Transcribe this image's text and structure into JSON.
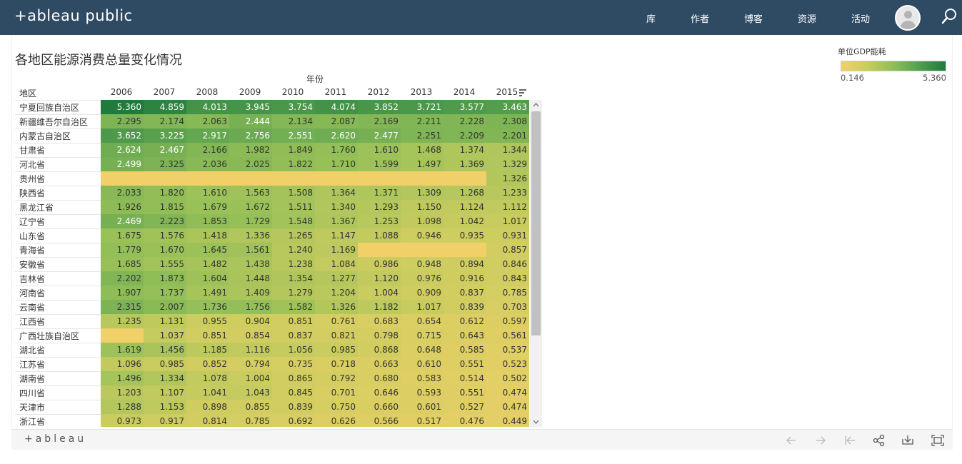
{
  "nav": {
    "logo_text": "+ableau public",
    "items": [
      "库",
      "作者",
      "博客",
      "资源",
      "活动"
    ]
  },
  "viz": {
    "title": "各地区能源消费总量变化情况",
    "column_header": "年份",
    "row_header": "地区",
    "legend": {
      "title": "单位GDP能耗",
      "min": "0.146",
      "max": "5.360"
    },
    "years": [
      "2006",
      "2007",
      "2008",
      "2009",
      "2010",
      "2011",
      "2012",
      "2013",
      "2014",
      "2015"
    ],
    "rows": [
      {
        "region": "宁夏回族自治区",
        "values": [
          "5.360",
          "4.859",
          "4.013",
          "3.945",
          "3.754",
          "4.074",
          "3.852",
          "3.721",
          "3.577",
          "3.463"
        ]
      },
      {
        "region": "新疆维吾尔自治区",
        "values": [
          "2.295",
          "2.174",
          "2.063",
          "2.444",
          "2.134",
          "2.087",
          "2.169",
          "2.211",
          "2.228",
          "2.308"
        ]
      },
      {
        "region": "内蒙古自治区",
        "values": [
          "3.652",
          "3.225",
          "2.917",
          "2.756",
          "2.551",
          "2.620",
          "2.477",
          "2.251",
          "2.209",
          "2.201"
        ]
      },
      {
        "region": "甘肃省",
        "values": [
          "2.624",
          "2.467",
          "2.166",
          "1.982",
          "1.849",
          "1.760",
          "1.610",
          "1.468",
          "1.374",
          "1.344"
        ]
      },
      {
        "region": "河北省",
        "values": [
          "2.499",
          "2.325",
          "2.036",
          "2.025",
          "1.822",
          "1.710",
          "1.599",
          "1.497",
          "1.369",
          "1.329"
        ]
      },
      {
        "region": "贵州省",
        "values": [
          "",
          "",
          "",
          "",
          "",
          "",
          "",
          "",
          "",
          "1.326"
        ]
      },
      {
        "region": "陕西省",
        "values": [
          "2.033",
          "1.820",
          "1.610",
          "1.563",
          "1.508",
          "1.364",
          "1.371",
          "1.309",
          "1.268",
          "1.233"
        ]
      },
      {
        "region": "黑龙江省",
        "values": [
          "1.926",
          "1.815",
          "1.679",
          "1.672",
          "1.511",
          "1.340",
          "1.293",
          "1.150",
          "1.124",
          "1.112"
        ]
      },
      {
        "region": "辽宁省",
        "values": [
          "2.469",
          "2.223",
          "1.853",
          "1.729",
          "1.548",
          "1.367",
          "1.253",
          "1.098",
          "1.042",
          "1.017"
        ]
      },
      {
        "region": "山东省",
        "values": [
          "1.675",
          "1.576",
          "1.418",
          "1.336",
          "1.265",
          "1.147",
          "1.088",
          "0.946",
          "0.935",
          "0.931"
        ]
      },
      {
        "region": "青海省",
        "values": [
          "1.779",
          "1.670",
          "1.645",
          "1.561",
          "1.240",
          "1.169",
          "",
          "",
          "",
          "0.857"
        ]
      },
      {
        "region": "安徽省",
        "values": [
          "1.685",
          "1.555",
          "1.482",
          "1.438",
          "1.238",
          "1.084",
          "0.986",
          "0.948",
          "0.894",
          "0.846"
        ]
      },
      {
        "region": "吉林省",
        "values": [
          "2.202",
          "1.873",
          "1.604",
          "1.448",
          "1.354",
          "1.277",
          "1.120",
          "0.976",
          "0.916",
          "0.843"
        ]
      },
      {
        "region": "河南省",
        "values": [
          "1.907",
          "1.737",
          "1.491",
          "1.409",
          "1.279",
          "1.204",
          "1.004",
          "0.909",
          "0.837",
          "0.785"
        ]
      },
      {
        "region": "云南省",
        "values": [
          "2.315",
          "2.007",
          "1.736",
          "1.756",
          "1.582",
          "1.326",
          "1.182",
          "1.017",
          "0.839",
          "0.703"
        ]
      },
      {
        "region": "江西省",
        "values": [
          "1.235",
          "1.131",
          "0.955",
          "0.904",
          "0.851",
          "0.761",
          "0.683",
          "0.654",
          "0.612",
          "0.597"
        ]
      },
      {
        "region": "广西壮族自治区",
        "values": [
          "",
          "1.037",
          "0.851",
          "0.854",
          "0.837",
          "0.821",
          "0.798",
          "0.715",
          "0.643",
          "0.561"
        ]
      },
      {
        "region": "湖北省",
        "values": [
          "1.619",
          "1.456",
          "1.185",
          "1.116",
          "1.056",
          "0.985",
          "0.868",
          "0.648",
          "0.585",
          "0.537"
        ]
      },
      {
        "region": "江苏省",
        "values": [
          "1.096",
          "0.985",
          "0.852",
          "0.794",
          "0.735",
          "0.718",
          "0.663",
          "0.610",
          "0.551",
          "0.523"
        ]
      },
      {
        "region": "湖南省",
        "values": [
          "1.496",
          "1.334",
          "1.078",
          "1.004",
          "0.865",
          "0.792",
          "0.680",
          "0.583",
          "0.514",
          "0.502"
        ]
      },
      {
        "region": "四川省",
        "values": [
          "1.203",
          "1.107",
          "1.041",
          "1.043",
          "0.845",
          "0.701",
          "0.646",
          "0.593",
          "0.551",
          "0.474"
        ]
      },
      {
        "region": "天津市",
        "values": [
          "1.288",
          "1.153",
          "0.898",
          "0.855",
          "0.839",
          "0.750",
          "0.660",
          "0.601",
          "0.527",
          "0.474"
        ]
      },
      {
        "region": "浙江省",
        "values": [
          "0.973",
          "0.917",
          "0.814",
          "0.785",
          "0.692",
          "0.626",
          "0.566",
          "0.517",
          "0.476",
          "0.449"
        ]
      }
    ]
  },
  "toolbar": {
    "logo_text": "+ableau",
    "buttons": [
      "undo-icon",
      "redo-icon",
      "revert-icon",
      "share-icon",
      "download-icon",
      "fullscreen-icon"
    ]
  },
  "colors": {
    "nav_bg": "#2f4a63",
    "heat_low": "#f2d069",
    "heat_high": "#1f7a3c"
  }
}
